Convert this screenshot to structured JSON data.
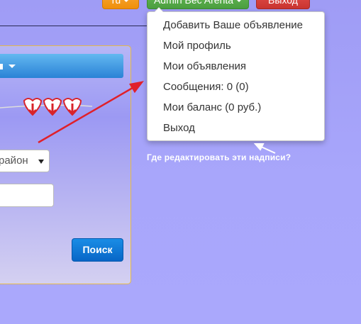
{
  "topbar": {
    "lang_label": "ru",
    "user_label": "Admin Bec Arenta",
    "exit_label": "Выход"
  },
  "dropdown": {
    "items": [
      "Добавить Ваше объявление",
      "Мой профиль",
      "Мои объявления",
      "Сообщения: 0 (0)",
      "Мои баланс (0 руб.)",
      "Выход"
    ]
  },
  "hint": "Где редактировать эти надписи?",
  "search_form": {
    "district_value": "район",
    "search_button": "Поиск"
  },
  "colors": {
    "annotation_arrow": "#e0202a",
    "accent_blue": "#0766c7",
    "orange": "#ef8f0b",
    "green": "#4b9e3f",
    "red": "#c93430"
  }
}
